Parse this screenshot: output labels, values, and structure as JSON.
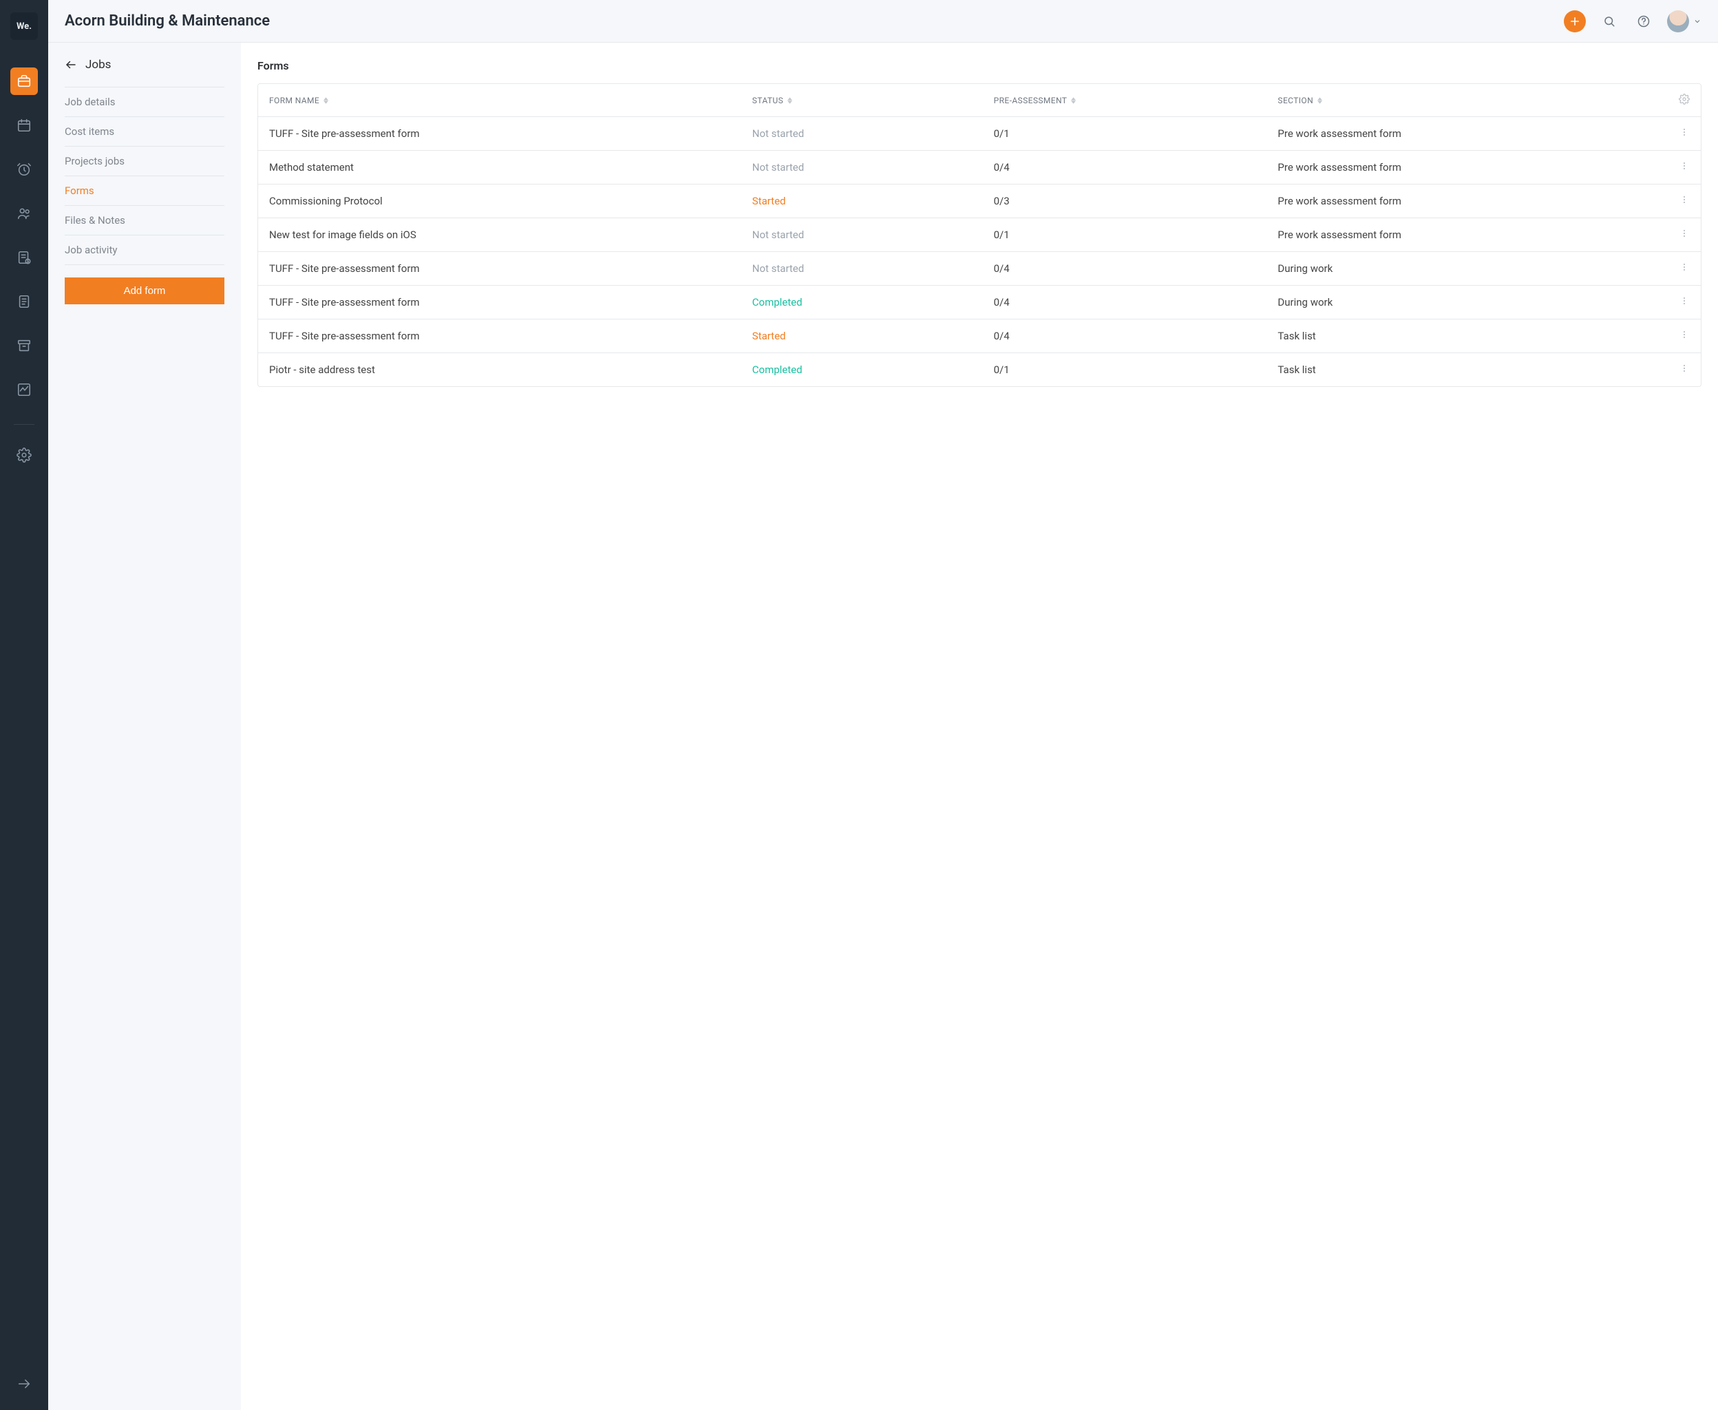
{
  "brand": {
    "logo_text": "We."
  },
  "header": {
    "title": "Acorn Building & Maintenance"
  },
  "rail_icons": [
    {
      "name": "briefcase",
      "active": true
    },
    {
      "name": "calendar",
      "active": false
    },
    {
      "name": "alarm",
      "active": false
    },
    {
      "name": "people",
      "active": false
    },
    {
      "name": "receipt",
      "active": false
    },
    {
      "name": "document",
      "active": false
    },
    {
      "name": "archive",
      "active": false
    },
    {
      "name": "activity",
      "active": false
    }
  ],
  "settings_icon": "gear",
  "panel": {
    "back_label": "Jobs",
    "nav": [
      {
        "label": "Job details",
        "active": false
      },
      {
        "label": "Cost items",
        "active": false
      },
      {
        "label": "Projects jobs",
        "active": false
      },
      {
        "label": "Forms",
        "active": true
      },
      {
        "label": "Files & Notes",
        "active": false
      },
      {
        "label": "Job activity",
        "active": false
      }
    ],
    "add_button": "Add form"
  },
  "main": {
    "heading": "Forms",
    "columns": {
      "form_name": "FORM NAME",
      "status": "STATUS",
      "pre": "PRE-ASSESSMENT",
      "section": "SECTION"
    },
    "rows": [
      {
        "name": "TUFF - Site pre-assessment form",
        "status": "Not started",
        "status_key": "notstarted",
        "pre": "0/1",
        "section": "Pre work assessment form"
      },
      {
        "name": "Method statement",
        "status": "Not started",
        "status_key": "notstarted",
        "pre": "0/4",
        "section": "Pre work assessment form"
      },
      {
        "name": "Commissioning Protocol",
        "status": "Started",
        "status_key": "started",
        "pre": "0/3",
        "section": "Pre work assessment form"
      },
      {
        "name": "New test for image fields on iOS",
        "status": "Not started",
        "status_key": "notstarted",
        "pre": "0/1",
        "section": "Pre work assessment form"
      },
      {
        "name": "TUFF - Site pre-assessment form",
        "status": "Not started",
        "status_key": "notstarted",
        "pre": "0/4",
        "section": "During work"
      },
      {
        "name": "TUFF - Site pre-assessment form",
        "status": "Completed",
        "status_key": "completed",
        "pre": "0/4",
        "section": "During work"
      },
      {
        "name": "TUFF - Site pre-assessment form",
        "status": "Started",
        "status_key": "started",
        "pre": "0/4",
        "section": "Task list"
      },
      {
        "name": "Piotr - site address test",
        "status": "Completed",
        "status_key": "completed",
        "pre": "0/1",
        "section": "Task list"
      }
    ]
  }
}
